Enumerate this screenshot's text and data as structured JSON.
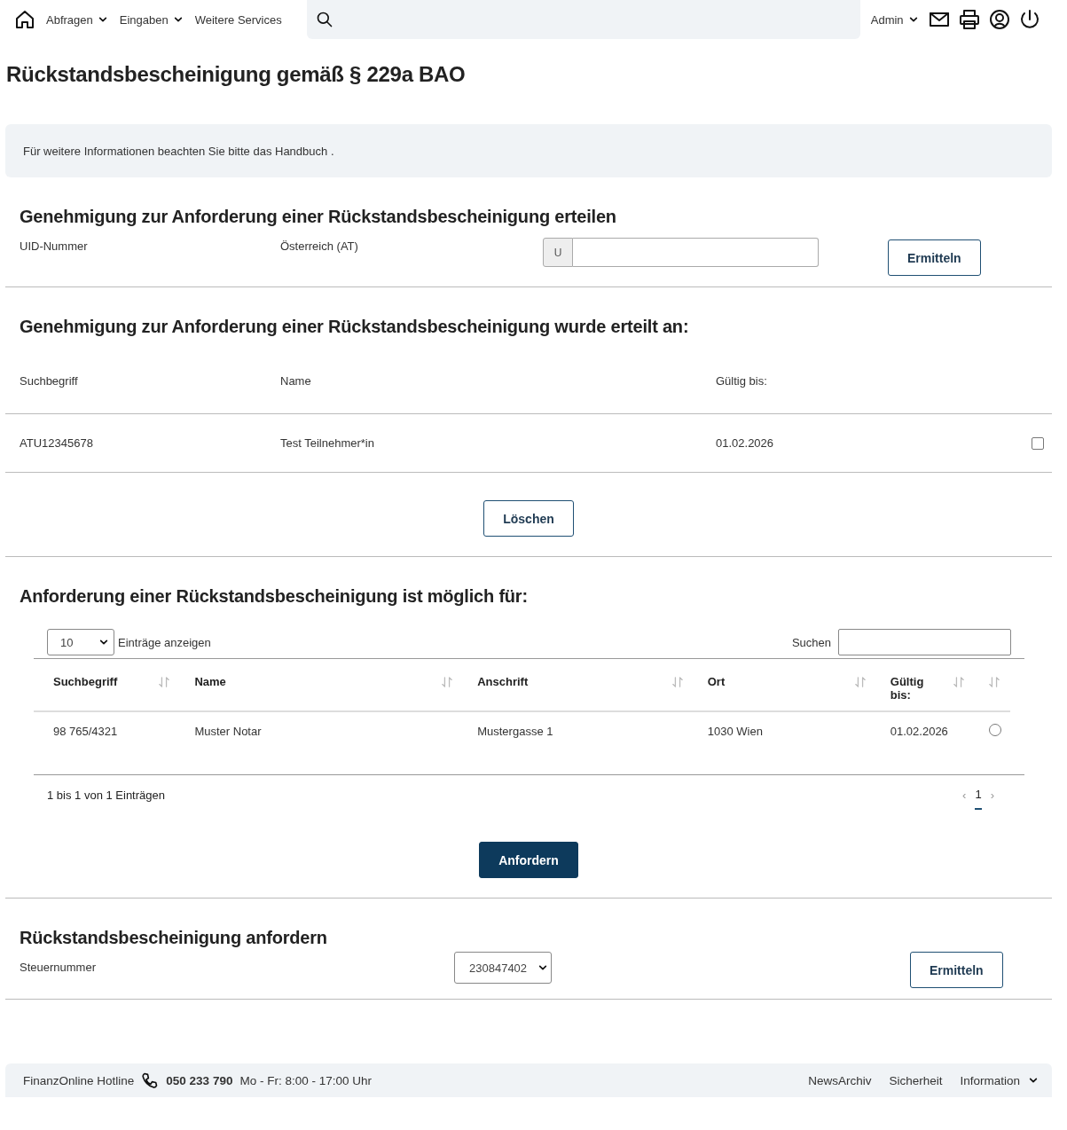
{
  "nav": {
    "items": [
      {
        "label": "Abfragen",
        "dropdown": true
      },
      {
        "label": "Eingaben",
        "dropdown": true
      },
      {
        "label": "Weitere Services",
        "dropdown": false
      }
    ],
    "user": {
      "label": "Admin",
      "dropdown": true
    }
  },
  "title": "Rückstandsbescheinigung gemäß § 229a BAO",
  "info": {
    "text": "Für weitere Informationen beachten Sie bitte das",
    "link": "Handbuch",
    "after": "."
  },
  "grant": {
    "heading": "Genehmigung zur Anforderung einer Rückstandsbescheinigung erteilen",
    "label": "UID-Nummer",
    "country": "Österreich (AT)",
    "prefix": "U",
    "button": "Ermitteln"
  },
  "granted": {
    "heading": "Genehmigung zur Anforderung einer Rückstandsbescheinigung wurde erteilt an:",
    "columns": [
      "Suchbegriff",
      "Name",
      "Gültig bis:"
    ],
    "rows": [
      {
        "cells": [
          "ATU12345678",
          "Test Teilnehmer*in",
          "01.02.2026"
        ],
        "checked": false
      }
    ],
    "button": "Löschen"
  },
  "possible": {
    "heading": "Anforderung einer Rückstandsbescheinigung ist möglich für:",
    "page_size": "10",
    "page_size_label": "Einträge anzeigen",
    "search_label": "Suchen",
    "columns": [
      "Suchbegriff",
      "Name",
      "Anschrift",
      "Ort",
      "Gültig bis:"
    ],
    "rows": [
      {
        "cells": [
          "98 765/4321",
          "Muster Notar",
          "Mustergasse 1",
          "1030 Wien",
          "01.02.2026"
        ],
        "selected": false
      }
    ],
    "summary": "1 bis 1 von 1 Einträgen",
    "prev": "‹",
    "pages": [
      {
        "label": "1",
        "selected": true
      }
    ],
    "next": "›",
    "button": "Anfordern"
  },
  "request": {
    "heading": "Rückstandsbescheinigung anfordern",
    "label": "Steuernummer",
    "value": "230847402",
    "button": "Ermitteln"
  },
  "footer": {
    "hotline": "FinanzOnline Hotline",
    "phone": "050 233 790",
    "hours": "Mo - Fr: 8:00 - 17:00 Uhr",
    "links": [
      {
        "label": "NewsArchiv",
        "dropdown": false
      },
      {
        "label": "Sicherheit",
        "dropdown": false
      },
      {
        "label": "Information",
        "dropdown": true
      }
    ]
  }
}
